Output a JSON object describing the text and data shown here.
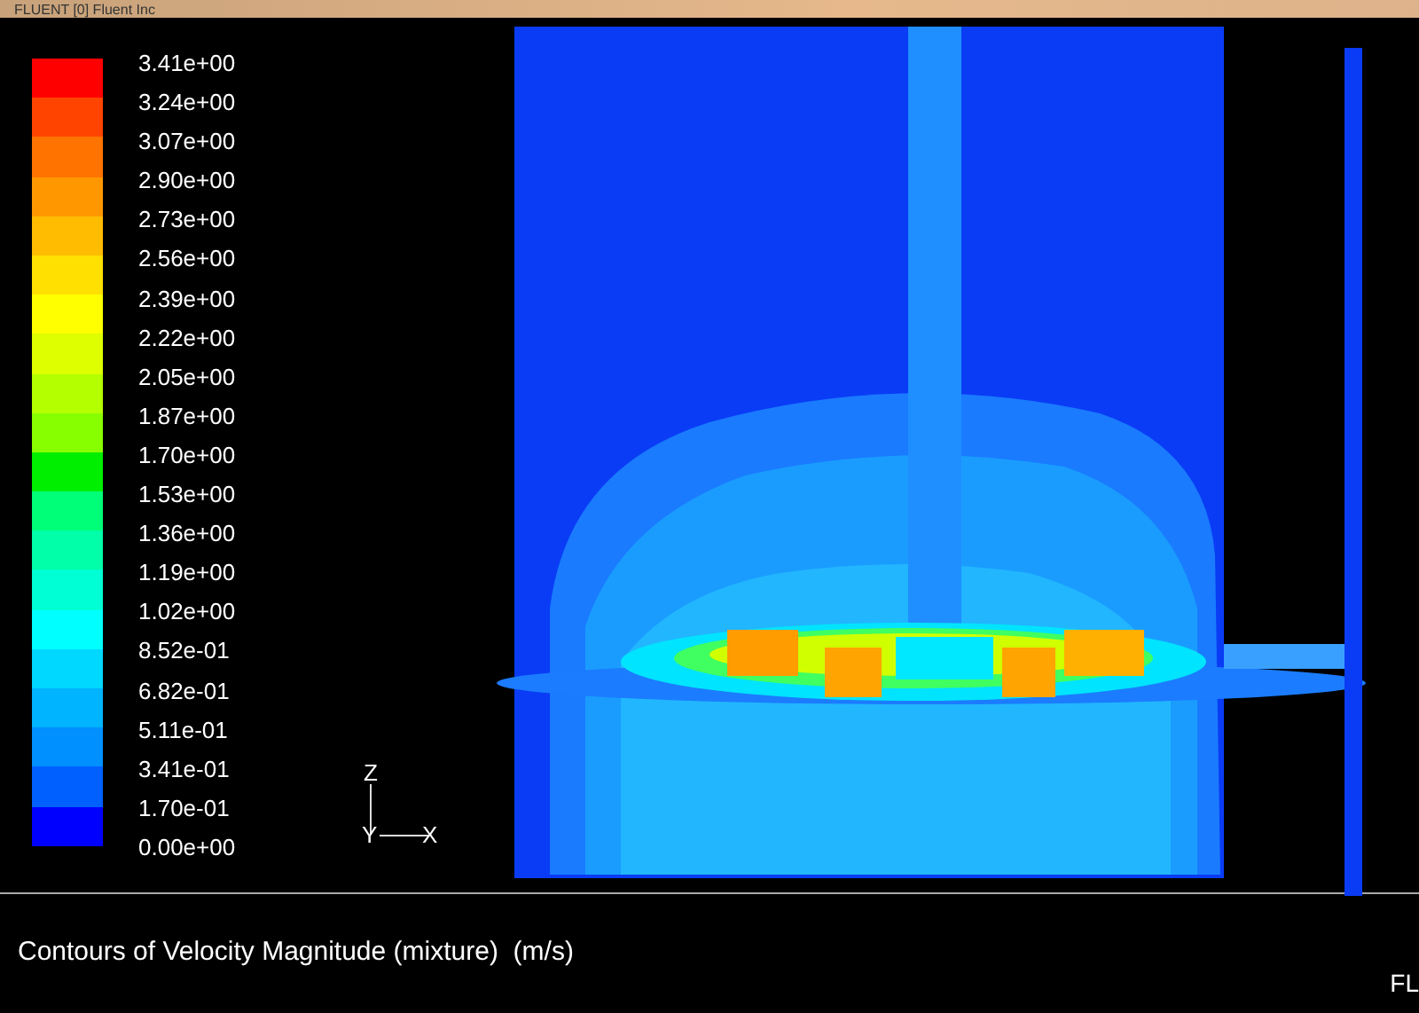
{
  "window": {
    "title": "FLUENT [0] Fluent Inc"
  },
  "legend": {
    "swatches": [
      {
        "color": "#ff0000"
      },
      {
        "color": "#ff4400"
      },
      {
        "color": "#ff7400"
      },
      {
        "color": "#ff9800"
      },
      {
        "color": "#ffbc00"
      },
      {
        "color": "#ffe000"
      },
      {
        "color": "#ffff00"
      },
      {
        "color": "#ddff00"
      },
      {
        "color": "#b4ff00"
      },
      {
        "color": "#88ff00"
      },
      {
        "color": "#00ee00"
      },
      {
        "color": "#00ff78"
      },
      {
        "color": "#00ffa8"
      },
      {
        "color": "#00ffd4"
      },
      {
        "color": "#00ffff"
      },
      {
        "color": "#00d8ff"
      },
      {
        "color": "#00b4ff"
      },
      {
        "color": "#0090ff"
      },
      {
        "color": "#0060ff"
      },
      {
        "color": "#0000ff"
      }
    ],
    "labels": [
      "3.41e+00",
      "3.24e+00",
      "3.07e+00",
      "2.90e+00",
      "2.73e+00",
      "2.56e+00",
      "2.39e+00",
      "2.22e+00",
      "2.05e+00",
      "1.87e+00",
      "1.70e+00",
      "1.53e+00",
      "1.36e+00",
      "1.19e+00",
      "1.02e+00",
      "8.52e-01",
      "6.82e-01",
      "5.11e-01",
      "3.41e-01",
      "1.70e-01",
      "0.00e+00"
    ]
  },
  "axes": {
    "vertical": "Z",
    "depth": "Y",
    "horizontal": "X"
  },
  "caption": "Contours of Velocity Magnitude (mixture)  (m/s)",
  "corner_text": "FL"
}
